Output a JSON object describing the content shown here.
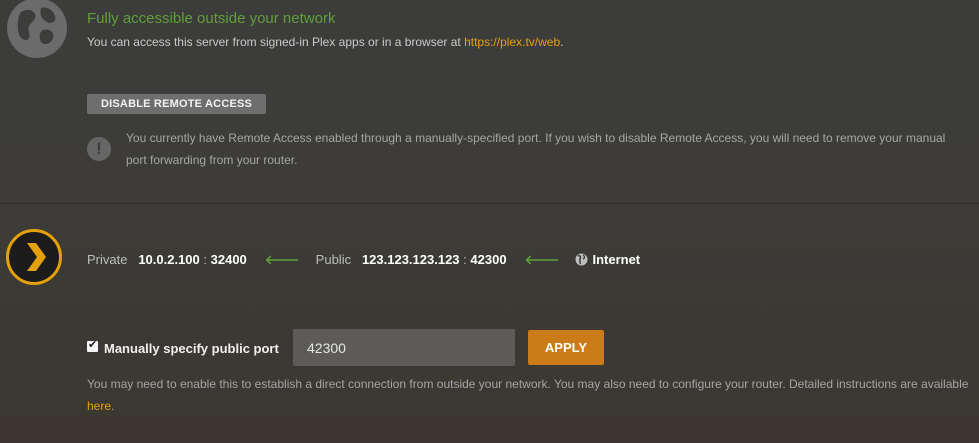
{
  "status": {
    "title": "Fully accessible outside your network",
    "desc_prefix": "You can access this server from signed-in Plex apps or in a browser at ",
    "desc_link": "https://plex.tv/web",
    "desc_suffix": "."
  },
  "remote": {
    "disable_button": "DISABLE REMOTE ACCESS",
    "warning_icon": "!",
    "warning_text": "You currently have Remote Access enabled through a manually-specified port. If you wish to disable Remote Access, you will need to remove your manual port forwarding from your router."
  },
  "connection": {
    "private_label": "Private",
    "private_ip": "10.0.2.100",
    "private_port": "32400",
    "public_label": "Public",
    "public_ip": "123.123.123.123",
    "public_port": "42300",
    "separator": ":",
    "arrow": "🡐",
    "internet_label": "Internet"
  },
  "manual_port": {
    "checked": true,
    "check_mark": "✔",
    "label": "Manually specify public port",
    "value": "42300",
    "apply_label": "APPLY",
    "help_prefix": "You may need to enable this to establish a direct connection from outside your network. You may also need to configure your router. Detailed instructions are available ",
    "help_link": "here",
    "help_suffix": "."
  },
  "colors": {
    "accent": "#e5a00d",
    "success": "#5f9e3a",
    "apply_button": "#cc7b19"
  },
  "icons": {
    "globe": "globe-icon",
    "warning": "warning-icon",
    "plex_logo": "plex-logo-icon",
    "internet": "internet-globe-icon"
  }
}
